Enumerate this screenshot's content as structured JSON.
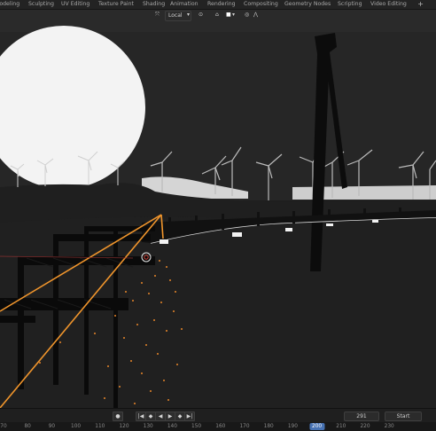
{
  "workspace_tabs": [
    "Modeling",
    "Sculpting",
    "UV Editing",
    "Texture Paint",
    "Shading",
    "Animation",
    "Rendering",
    "Compositing",
    "Geometry Nodes",
    "Scripting",
    "Video Editing"
  ],
  "add_workspace": "+",
  "toolbar": {
    "transform_space": "Local"
  },
  "playback": {
    "current_frame": "291",
    "start_label": "Start"
  },
  "ruler_ticks": [
    "70",
    "80",
    "90",
    "100",
    "110",
    "120",
    "130",
    "140",
    "150",
    "160",
    "170",
    "180",
    "190",
    "200",
    "210",
    "220",
    "230"
  ],
  "ruler_current": "200",
  "colors": {
    "accent": "#4772b3",
    "selection_orange": "#f0952c",
    "bg": "#1d1d1d"
  },
  "icons": [
    "transform-icon",
    "snap-icon",
    "proportional-icon",
    "play-icon",
    "jump-start-icon",
    "prev-key-icon",
    "reverse-play-icon",
    "next-key-icon",
    "jump-end-icon",
    "record-icon"
  ]
}
